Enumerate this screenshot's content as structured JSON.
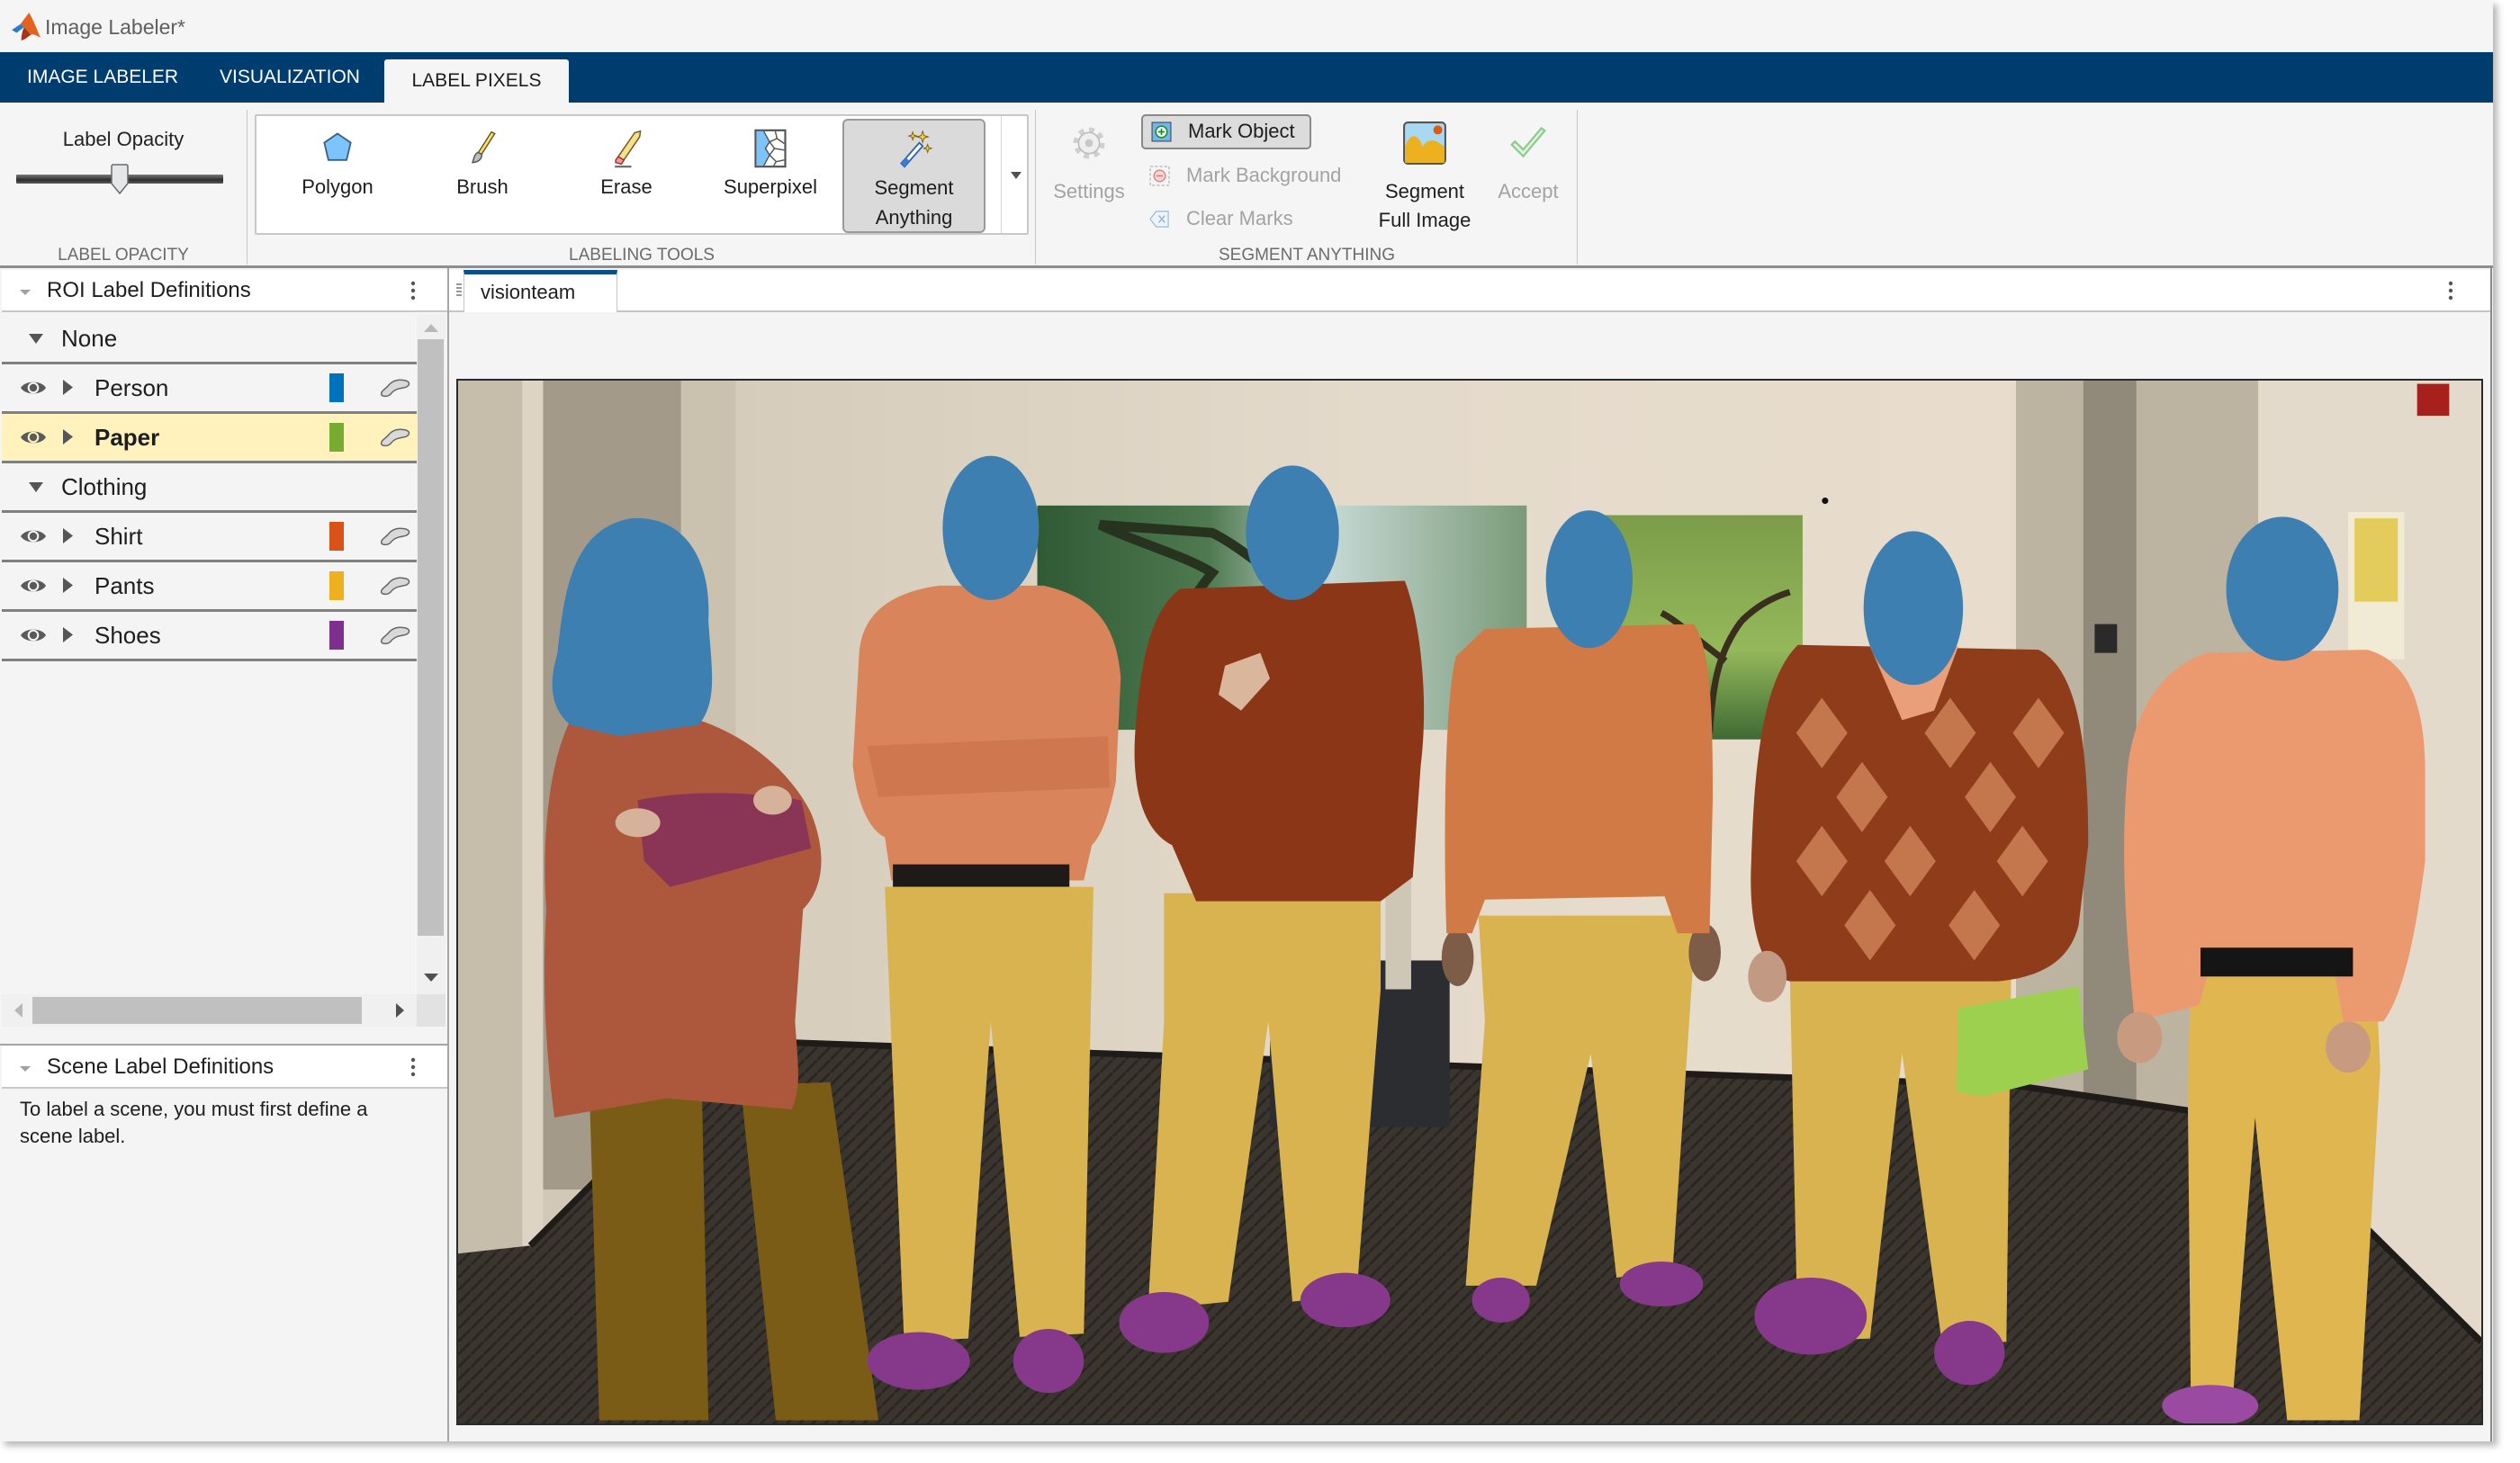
{
  "window": {
    "title": "Image Labeler*"
  },
  "tabs": [
    {
      "label": "IMAGE LABELER",
      "active": false
    },
    {
      "label": "VISUALIZATION",
      "active": false
    },
    {
      "label": "LABEL PIXELS",
      "active": true
    }
  ],
  "toolstrip": {
    "label_opacity": {
      "label": "Label Opacity",
      "value": 0.5,
      "section_title": "LABEL OPACITY"
    },
    "labeling_tools": {
      "section_title": "LABELING TOOLS",
      "tools": [
        {
          "label": "Polygon",
          "icon": "polygon-icon"
        },
        {
          "label": "Brush",
          "icon": "brush-icon"
        },
        {
          "label": "Erase",
          "icon": "eraser-icon"
        },
        {
          "label": "Superpixel",
          "icon": "superpixel-icon"
        },
        {
          "label_line1": "Segment",
          "label_line2": "Anything",
          "icon": "magic-wand-icon",
          "selected": true
        }
      ]
    },
    "segment_anything": {
      "section_title": "SEGMENT ANYTHING",
      "settings": "Settings",
      "mark_object": "Mark Object",
      "mark_background": "Mark Background",
      "clear_marks": "Clear Marks",
      "segment_full_image_line1": "Segment",
      "segment_full_image_line2": "Full Image",
      "accept": "Accept"
    }
  },
  "roi_panel": {
    "title": "ROI Label Definitions",
    "groups": [
      {
        "name": "None",
        "labels": [
          {
            "name": "Person",
            "color": "#0072BD"
          },
          {
            "name": "Paper",
            "color": "#77AC30",
            "selected": true
          }
        ]
      },
      {
        "name": "Clothing",
        "labels": [
          {
            "name": "Shirt",
            "color": "#D95319"
          },
          {
            "name": "Pants",
            "color": "#EDB120"
          },
          {
            "name": "Shoes",
            "color": "#7E2F8E"
          }
        ]
      }
    ]
  },
  "scene_panel": {
    "title": "Scene Label Definitions",
    "message": "To label a scene, you must first define a scene label."
  },
  "document": {
    "tab": "visionteam"
  }
}
